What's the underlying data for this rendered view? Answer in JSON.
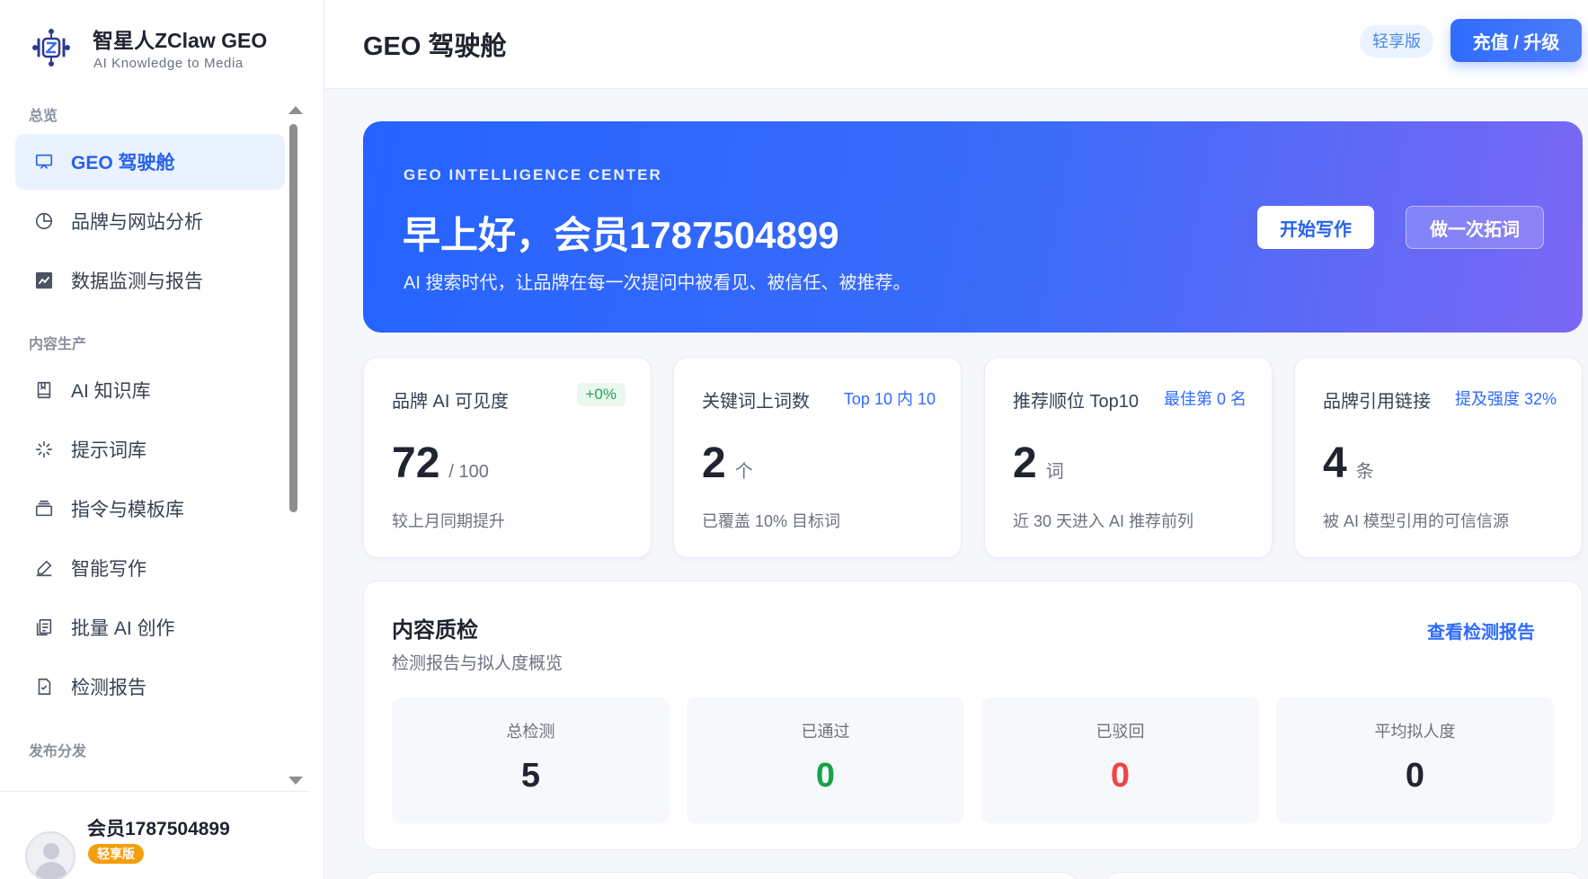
{
  "brand": {
    "title": "智星人ZClaw GEO",
    "subtitle": "AI Knowledge to Media"
  },
  "sidebar": {
    "sections": [
      {
        "label": "总览"
      },
      {
        "label": "内容生产"
      },
      {
        "label": "发布分发"
      }
    ],
    "items": [
      {
        "label": "GEO 驾驶舱",
        "icon": "presentation-icon",
        "active": true
      },
      {
        "label": "品牌与网站分析",
        "icon": "pie-chart-icon"
      },
      {
        "label": "数据监测与报告",
        "icon": "line-chart-icon"
      },
      {
        "label": "AI 知识库",
        "icon": "book-icon"
      },
      {
        "label": "提示词库",
        "icon": "sparkle-icon"
      },
      {
        "label": "指令与模板库",
        "icon": "stack-icon"
      },
      {
        "label": "智能写作",
        "icon": "pen-icon"
      },
      {
        "label": "批量 AI 创作",
        "icon": "copy-document-icon"
      },
      {
        "label": "检测报告",
        "icon": "file-check-icon"
      }
    ]
  },
  "user": {
    "name": "会员1787504899",
    "plan": "轻享版"
  },
  "topbar": {
    "title": "GEO 驾驶舱",
    "plan_chip": "轻享版",
    "upgrade_label": "充值 / 升级"
  },
  "hero": {
    "eyebrow": "GEO INTELLIGENCE CENTER",
    "greeting": "早上好，会员1787504899",
    "description": "AI 搜索时代，让品牌在每一次提问中被看见、被信任、被推荐。",
    "primary_button": "开始写作",
    "secondary_button": "做一次拓词"
  },
  "stats": [
    {
      "label": "品牌 AI 可见度",
      "tag": "+0%",
      "value": "72",
      "unit": "/ 100",
      "note": "较上月同期提升"
    },
    {
      "label": "关键词上词数",
      "tag": "Top 10 内 10",
      "value": "2",
      "unit": "个",
      "note": "已覆盖 10% 目标词"
    },
    {
      "label": "推荐顺位 Top10",
      "tag": "最佳第 0 名",
      "value": "2",
      "unit": "词",
      "note": "近 30 天进入 AI 推荐前列"
    },
    {
      "label": "品牌引用链接",
      "tag": "提及强度 32%",
      "value": "4",
      "unit": "条",
      "note": "被 AI 模型引用的可信信源"
    }
  ],
  "quality": {
    "title": "内容质检",
    "subtitle": "检测报告与拟人度概览",
    "link": "查看检测报告",
    "tiles": [
      {
        "label": "总检测",
        "value": "5",
        "color": "#1f2430"
      },
      {
        "label": "已通过",
        "value": "0",
        "color": "#16a34a"
      },
      {
        "label": "已驳回",
        "value": "0",
        "color": "#ef4444"
      },
      {
        "label": "平均拟人度",
        "value": "0",
        "color": "#1f2430"
      }
    ]
  }
}
